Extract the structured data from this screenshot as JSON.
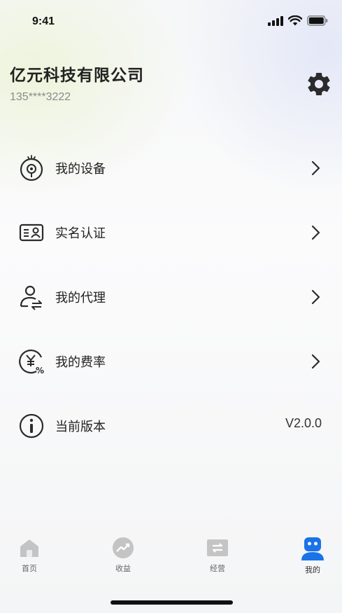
{
  "status": {
    "time": "9:41"
  },
  "profile": {
    "company_name": "亿元科技有限公司",
    "phone": "135****3222"
  },
  "menu": {
    "items": [
      {
        "label": "我的设备",
        "icon": "device-icon"
      },
      {
        "label": "实名认证",
        "icon": "id-card-icon"
      },
      {
        "label": "我的代理",
        "icon": "agent-icon"
      },
      {
        "label": "我的费率",
        "icon": "rate-icon"
      },
      {
        "label": "当前版本",
        "icon": "info-icon",
        "value": "V2.0.0"
      }
    ]
  },
  "tabbar": {
    "tabs": [
      {
        "label": "首页",
        "icon": "home-icon"
      },
      {
        "label": "收益",
        "icon": "earnings-icon"
      },
      {
        "label": "经营",
        "icon": "business-icon"
      },
      {
        "label": "我的",
        "icon": "profile-icon",
        "active": true
      }
    ]
  },
  "colors": {
    "accent": "#1a73e8",
    "tab_inactive": "#c4c4c4"
  }
}
